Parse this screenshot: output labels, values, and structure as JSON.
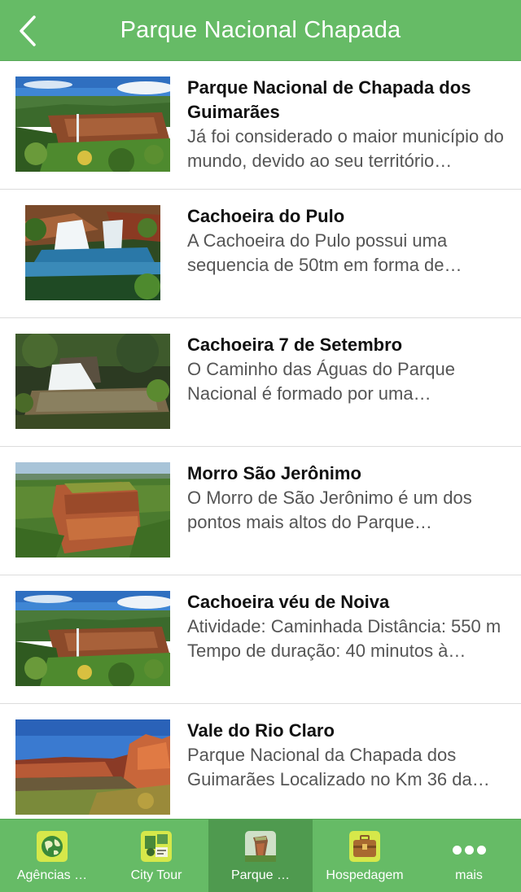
{
  "header": {
    "title": "Parque Nacional Chapada",
    "back_icon": "chevron-left-icon"
  },
  "colors": {
    "primary": "#66bb66",
    "active_tab": "#4f9a4f",
    "title_text": "#111111",
    "desc_text": "#555555"
  },
  "items": [
    {
      "title": "Parque Nacional de Chapada dos Guimarães",
      "description": "Já foi considerado o maior município do mundo, devido ao seu território…",
      "image": "waterfall-cliff"
    },
    {
      "title": "Cachoeira do Pulo",
      "description": "A Cachoeira do Pulo possui uma sequencia de 50tm em forma de…",
      "image": "waterfall-pool"
    },
    {
      "title": "Cachoeira 7 de Setembro",
      "description": "O Caminho das Águas do Parque Nacional é formado por uma…",
      "image": "forest-waterfall"
    },
    {
      "title": "Morro São Jerônimo",
      "description": "O Morro de São Jerônimo é um dos pontos mais altos do Parque…",
      "image": "mesa-hill"
    },
    {
      "title": "Cachoeira véu de Noiva",
      "description": "Atividade: Caminhada Distância: 550 m Tempo de duração: 40 minutos à…",
      "image": "waterfall-cliff"
    },
    {
      "title": "Vale do Rio Claro",
      "description": "Parque Nacional da Chapada dos Guimarães Localizado no Km 36 da…",
      "image": "red-canyon"
    }
  ],
  "tabbar": {
    "tabs": [
      {
        "label": "Agências …",
        "icon": "globe-icon",
        "active": false
      },
      {
        "label": "City Tour",
        "icon": "city-tour-icon",
        "active": false
      },
      {
        "label": "Parque …",
        "icon": "rock-formation-icon",
        "active": true
      },
      {
        "label": "Hospedagem",
        "icon": "suitcase-icon",
        "active": false
      },
      {
        "label": "mais",
        "icon": "more-dots-icon",
        "active": false
      }
    ]
  }
}
